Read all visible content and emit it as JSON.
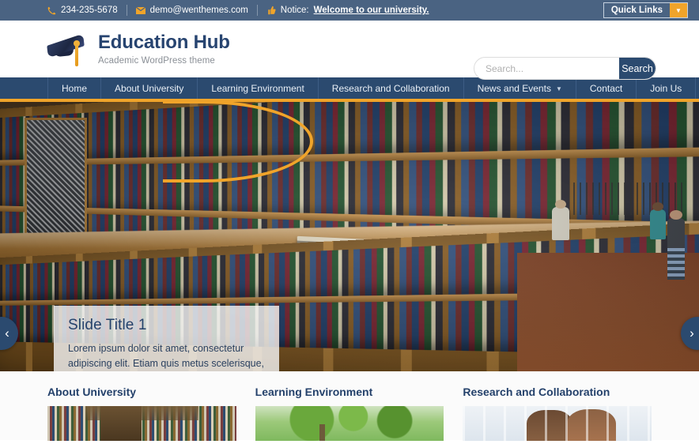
{
  "topbar": {
    "phone": "234-235-5678",
    "phone_icon": "phone-icon",
    "email": "demo@wenthemes.com",
    "email_icon": "envelope-icon",
    "notice_icon": "thumbs-up-icon",
    "notice_label": "Notice:",
    "notice_link": "Welcome to our university.",
    "quick_links_label": "Quick Links",
    "quick_links_caret": "▼",
    "bg_color": "#4a6382",
    "accent_color": "#f0a42a"
  },
  "header": {
    "logo_icon": "graduation-cap-icon",
    "site_title": "Education Hub",
    "site_description": "Academic WordPress theme",
    "title_color": "#274470"
  },
  "search": {
    "placeholder": "Search...",
    "value": "",
    "button_label": "Search",
    "button_color": "#2b4a6f"
  },
  "nav": {
    "bg_color": "#2b4a6f",
    "underline_color": "#f0a42a",
    "items": [
      {
        "label": "Home",
        "has_dropdown": false,
        "caret": ""
      },
      {
        "label": "About University",
        "has_dropdown": false,
        "caret": ""
      },
      {
        "label": "Learning Environment",
        "has_dropdown": false,
        "caret": ""
      },
      {
        "label": "Research and Collaboration",
        "has_dropdown": false,
        "caret": ""
      },
      {
        "label": "News and Events",
        "has_dropdown": true,
        "caret": "▼"
      },
      {
        "label": "Contact",
        "has_dropdown": false,
        "caret": ""
      },
      {
        "label": "Join Us",
        "has_dropdown": false,
        "caret": ""
      }
    ]
  },
  "slider": {
    "image_description": "Library interior with long wooden bookshelves, reading counter and visitors",
    "caption_title": "Slide Title 1",
    "caption_text": "Lorem ipsum dolor sit amet, consectetur adipiscing elit. Etiam quis metus scelerisque, faucibus risus eu, luctus est.",
    "prev_icon": "chevron-left-icon",
    "next_icon": "chevron-right-icon",
    "prev_glyph": "‹",
    "next_glyph": "›",
    "arc_color": "#f0a42a"
  },
  "features": [
    {
      "title": "About University",
      "thumb_name": "library-shelves-thumbnail",
      "thumb_class": "thumb-library"
    },
    {
      "title": "Learning Environment",
      "thumb_name": "campus-park-thumbnail",
      "thumb_class": "thumb-park"
    },
    {
      "title": "Research and Collaboration",
      "thumb_name": "students-collaborating-thumbnail",
      "thumb_class": "thumb-people"
    }
  ]
}
